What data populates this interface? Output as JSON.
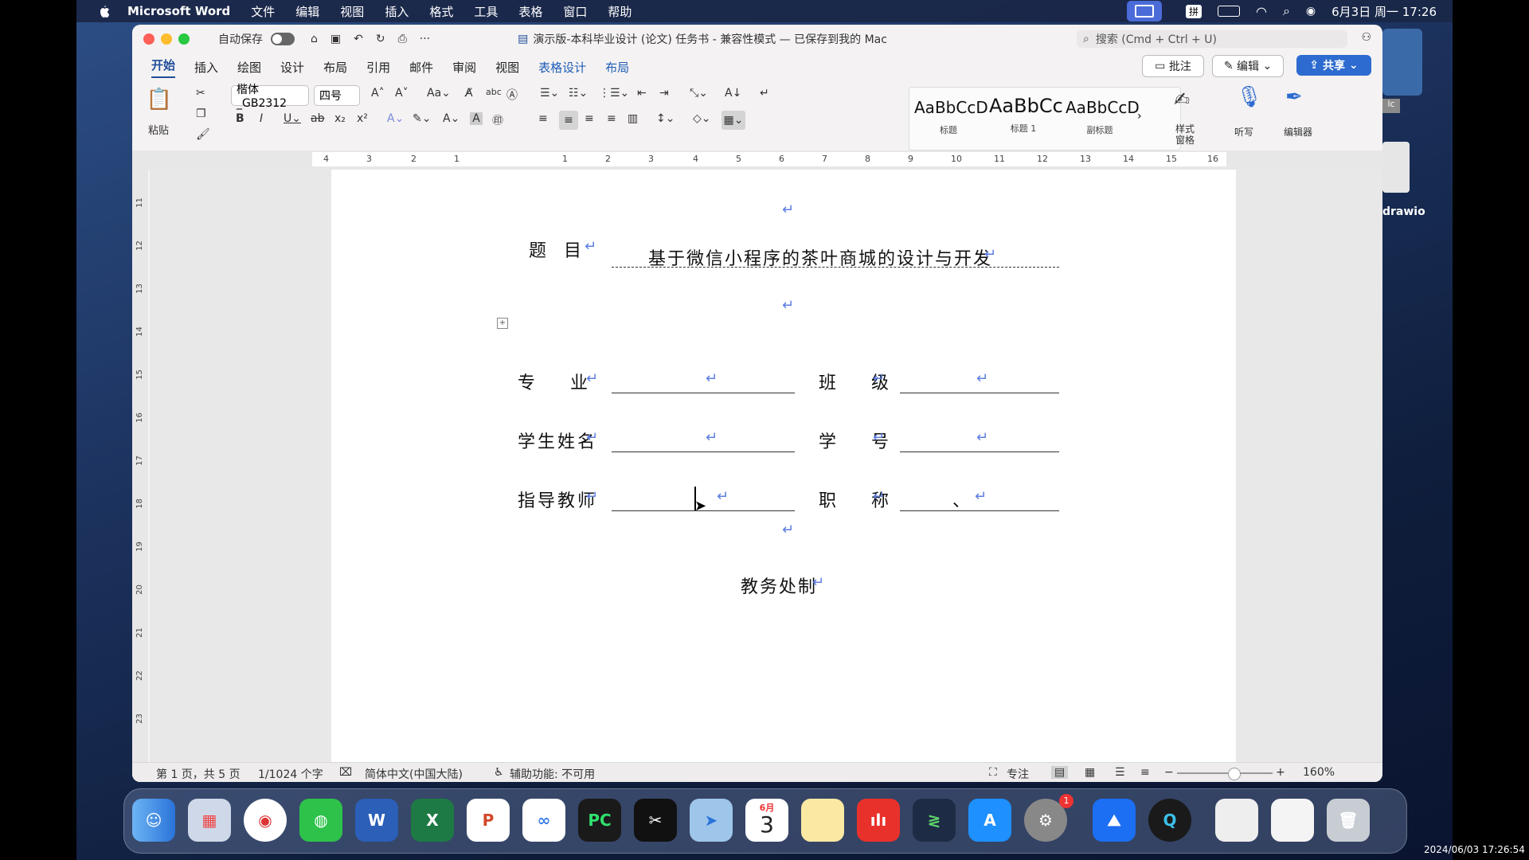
{
  "menubar": {
    "app": "Microsoft Word",
    "items": [
      "文件",
      "编辑",
      "视图",
      "插入",
      "格式",
      "工具",
      "表格",
      "窗口",
      "帮助"
    ],
    "ime": "拼",
    "datetime": "6月3日 周一 17:26"
  },
  "window": {
    "autosave": "自动保存",
    "title": "演示版-本科毕业设计 (论文) 任务书 - 兼容性模式 — 已保存到我的 Mac",
    "search_placeholder": "搜索 (Cmd + Ctrl + U)"
  },
  "tabs": [
    "开始",
    "插入",
    "绘图",
    "设计",
    "布局",
    "引用",
    "邮件",
    "审阅",
    "视图",
    "表格设计",
    "布局"
  ],
  "actions": {
    "comment": "批注",
    "edit": "编辑",
    "share": "共享"
  },
  "ribbon": {
    "paste": "粘贴",
    "font": "楷体_GB2312",
    "size": "四号",
    "styles": [
      {
        "preview": "AaBbCcD",
        "name": "标题"
      },
      {
        "preview": "AaBbCc",
        "name": "标题 1"
      },
      {
        "preview": "AaBbCcD",
        "name": "副标题"
      }
    ],
    "style_pane": "样式\n窗格",
    "dictate": "听写",
    "editor": "编辑器"
  },
  "ruler": {
    "marks": [
      "4",
      "3",
      "2",
      "1",
      "1",
      "2",
      "3",
      "4",
      "5",
      "6",
      "7",
      "8",
      "9",
      "10",
      "11",
      "12",
      "13",
      "14",
      "15",
      "16"
    ],
    "vmarks": [
      "11",
      "12",
      "13",
      "14",
      "15",
      "16",
      "17",
      "18",
      "19",
      "20",
      "21",
      "22",
      "23"
    ]
  },
  "document": {
    "title_label": "题　目",
    "title_value": "基于微信小程序的茶叶商城的设计与开发",
    "major": "专　　业",
    "class": "班　　级",
    "student_name": "学生姓名",
    "student_id": "学　　号",
    "advisor": "指导教师",
    "position": "职　　称",
    "position_mark": "、",
    "footer": "教务处制"
  },
  "status": {
    "page": "第 1 页，共 5 页",
    "words": "1/1024 个字",
    "lang": "简体中文(中国大陆)",
    "accessibility": "辅助功能: 不可用",
    "focus": "专注",
    "zoom": "160%"
  },
  "desktop": {
    "file_label": "drawio",
    "timestamp": "2024/06/03 17:26:54"
  },
  "dock": {
    "calendar_month": "6月",
    "calendar_day": "3",
    "notification_badge": "1"
  }
}
